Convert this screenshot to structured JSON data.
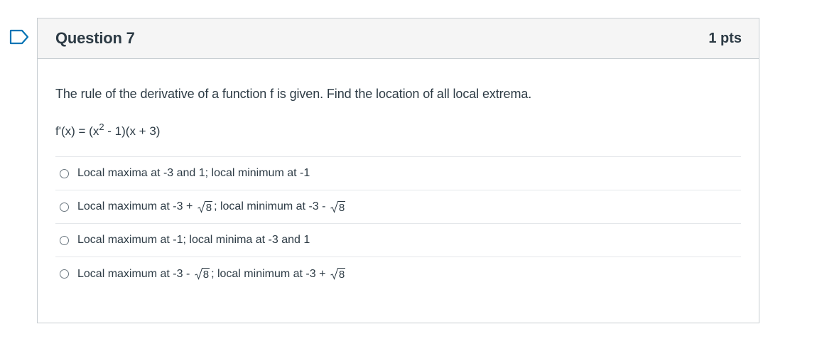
{
  "question": {
    "title": "Question 7",
    "points": "1 pts",
    "prompt": "The rule of the derivative of a function f is given. Find the location of all local extrema.",
    "formula": {
      "lhs": "f'(x) = (x",
      "exponent": "2",
      "rhs": " - 1)(x + 3)"
    }
  },
  "answers": [
    {
      "parts": [
        "Local maxima at -3 and 1; local minimum at -1"
      ]
    },
    {
      "pre": "Local maximum at -3 + ",
      "radicand1": "8",
      "mid": "; local minimum at -3 - ",
      "radicand2": "8"
    },
    {
      "parts": [
        "Local maximum at -1; local minima at -3 and 1"
      ]
    },
    {
      "pre": "Local maximum at -3 - ",
      "radicand1": "8",
      "mid": "; local minimum at -3 + ",
      "radicand2": "8"
    }
  ],
  "icons": {
    "flag": "flag-question-icon",
    "radio": "radio-unchecked-icon",
    "sqrt": "square-root-icon"
  },
  "colors": {
    "text": "#2d3b45",
    "border": "#c7cdd1",
    "header_bg": "#f5f5f5",
    "flag_stroke": "#0374b5"
  }
}
